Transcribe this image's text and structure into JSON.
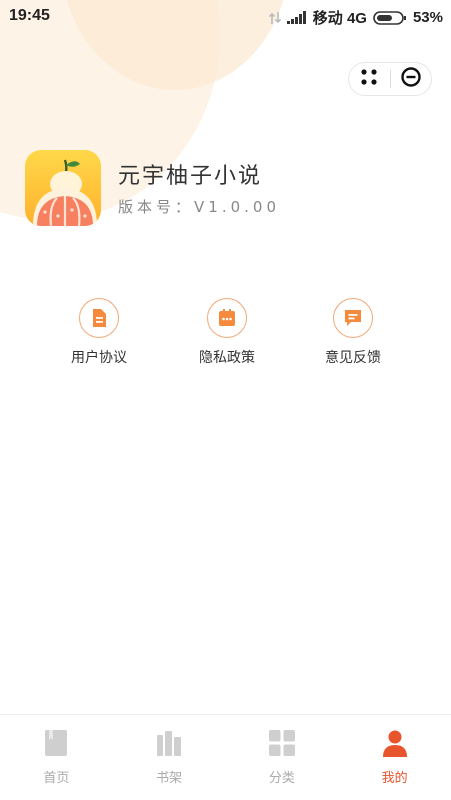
{
  "status_bar": {
    "time": "19:45",
    "carrier": "移动 4G",
    "battery": "53%"
  },
  "app": {
    "name": "元宇柚子小说",
    "version_label": "版本号：",
    "version": "V1.0.00"
  },
  "links": [
    {
      "label": "用户协议",
      "icon": "document-icon"
    },
    {
      "label": "隐私政策",
      "icon": "calendar-icon"
    },
    {
      "label": "意见反馈",
      "icon": "chat-icon"
    }
  ],
  "tabbar": {
    "items": [
      {
        "label": "首页",
        "icon": "book-icon",
        "active": false
      },
      {
        "label": "书架",
        "icon": "bookshelf-icon",
        "active": false
      },
      {
        "label": "分类",
        "icon": "grid-icon",
        "active": false
      },
      {
        "label": "我的",
        "icon": "user-icon",
        "active": true
      }
    ]
  },
  "colors": {
    "accent": "#f58a3c",
    "active_tab": "#e8542c",
    "inactive_tab": "#cfcfcf"
  }
}
